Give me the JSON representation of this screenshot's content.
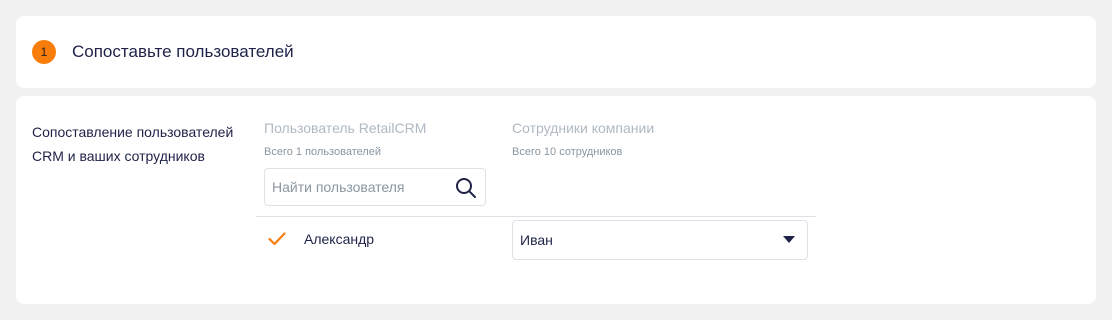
{
  "step": {
    "number": "1",
    "title": "Сопоставьте пользователей"
  },
  "mapping": {
    "description": "Сопоставление пользователей\nCRM и ваших сотрудников",
    "users_column": {
      "title": "Пользователь RetailCRM",
      "subtitle": "Всего 1 пользователей"
    },
    "employees_column": {
      "title": "Сотрудники компании",
      "subtitle": "Всего 10 сотрудников"
    },
    "search": {
      "placeholder": "Найти пользователя",
      "value": ""
    },
    "rows": [
      {
        "user": "Александр",
        "matched": true,
        "employee": "Иван"
      }
    ]
  },
  "icons": {
    "search": "search-icon",
    "check": "check-icon",
    "dropdown": "caret-down-icon"
  },
  "colors": {
    "accent": "#f97d0b",
    "text": "#1e2248",
    "muted": "#afb9c3",
    "background": "#f0f1f0"
  }
}
